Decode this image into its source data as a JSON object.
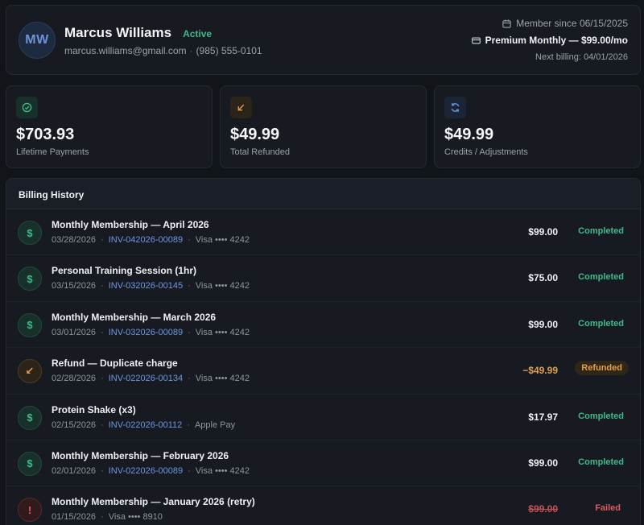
{
  "profile": {
    "initials": "MW",
    "name": "Marcus Williams",
    "status": "Active",
    "email": "marcus.williams@gmail.com",
    "phone": "(985) 555-0101",
    "contact_sep": "·",
    "member_since": "Member since 06/15/2025",
    "plan": "Premium Monthly — $99.00/mo",
    "next_billing": "Next billing: 04/01/2026"
  },
  "stats": [
    {
      "amount": "$703.93",
      "label": "Lifetime Payments",
      "icon": "check-circle-icon",
      "color": "#3fb88a"
    },
    {
      "amount": "$49.99",
      "label": "Total Refunded",
      "icon": "arrow-down-left-icon",
      "color": "#e0a04a"
    },
    {
      "amount": "$49.99",
      "label": "Credits / Adjustments",
      "icon": "refresh-icon",
      "color": "#6d96e0"
    }
  ],
  "history": {
    "title": "Billing History",
    "rows": [
      {
        "title": "Monthly Membership — April 2026",
        "date": "03/28/2026",
        "invoice": "INV-042026-00089",
        "method": "Visa •••• 4242",
        "amount": "$99.00",
        "status": "Completed",
        "icon": "dollar-icon",
        "glyph": "$"
      },
      {
        "title": "Personal Training Session (1hr)",
        "date": "03/15/2026",
        "invoice": "INV-032026-00145",
        "method": "Visa •••• 4242",
        "amount": "$75.00",
        "status": "Completed",
        "icon": "dollar-icon",
        "glyph": "$"
      },
      {
        "title": "Monthly Membership — March 2026",
        "date": "03/01/2026",
        "invoice": "INV-032026-00089",
        "method": "Visa •••• 4242",
        "amount": "$99.00",
        "status": "Completed",
        "icon": "dollar-icon",
        "glyph": "$"
      },
      {
        "title": "Refund — Duplicate charge",
        "date": "02/28/2026",
        "invoice": "INV-022026-00134",
        "method": "Visa •••• 4242",
        "amount": "−$49.99",
        "status": "Refunded",
        "icon": "arrow-down-left-icon",
        "glyph": "↙"
      },
      {
        "title": "Protein Shake (x3)",
        "date": "02/15/2026",
        "invoice": "INV-022026-00112",
        "method": "Apple Pay",
        "amount": "$17.97",
        "status": "Completed",
        "icon": "dollar-icon",
        "glyph": "$"
      },
      {
        "title": "Monthly Membership — February 2026",
        "date": "02/01/2026",
        "invoice": "INV-022026-00089",
        "method": "Visa •••• 4242",
        "amount": "$99.00",
        "status": "Completed",
        "icon": "dollar-icon",
        "glyph": "$"
      },
      {
        "title": "Monthly Membership — January 2026 (retry)",
        "date": "01/15/2026",
        "invoice": "",
        "method": "Visa •••• 8910",
        "amount": "$99.00",
        "status": "Failed",
        "icon": "alert-circle-icon",
        "glyph": "!"
      }
    ]
  }
}
